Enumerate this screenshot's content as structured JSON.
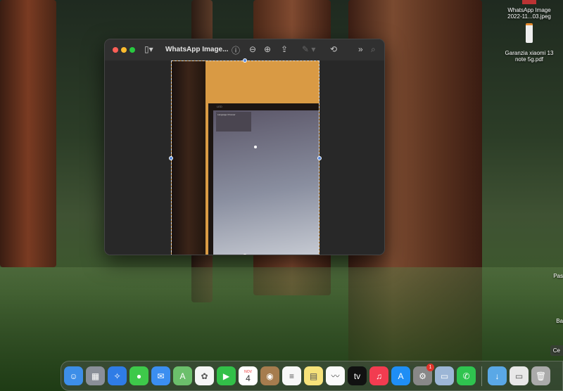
{
  "desktop": {
    "files": [
      {
        "name": "WhatsApp Image 2022-11...03.jpeg",
        "line1": "WhatsApp Image",
        "line2": "2022-11...03.jpeg"
      },
      {
        "name": "Garanzia xiaomi 13 note 5g.pdf",
        "line1": "Garanzia xiaomi 13",
        "line2": "note 5g.pdf"
      }
    ],
    "edge_labels": [
      "Pas",
      "Ba",
      "Ce"
    ]
  },
  "preview": {
    "title": "WhatsApp Image...",
    "toolbar": [
      "sidebar-toggle",
      "info",
      "zoom-out",
      "zoom-in",
      "share",
      "markup",
      "rotate",
      "more",
      "search"
    ],
    "photo_screen_text": "Language Chooser",
    "monitor_label": "LED"
  },
  "dock": {
    "apps": [
      {
        "name": "Finder",
        "color": "#3d8ee8",
        "glyph": "☺"
      },
      {
        "name": "Launchpad",
        "color": "#8a8f99",
        "glyph": "▦"
      },
      {
        "name": "Safari",
        "color": "#2f7ce6",
        "glyph": "✧"
      },
      {
        "name": "Messages",
        "color": "#3ec94a",
        "glyph": "●"
      },
      {
        "name": "Mail",
        "color": "#3b8ef0",
        "glyph": "✉"
      },
      {
        "name": "Maps",
        "color": "#6bbf6b",
        "glyph": "A"
      },
      {
        "name": "Photos",
        "color": "#f5f5f5",
        "glyph": "✿"
      },
      {
        "name": "FaceTime",
        "color": "#32c048",
        "glyph": "▶"
      },
      {
        "name": "Calendar",
        "color": "#ffffff",
        "month": "NOV",
        "day": "4"
      },
      {
        "name": "Contacts",
        "color": "#a67c4e",
        "glyph": "◉"
      },
      {
        "name": "Reminders",
        "color": "#f7f7f7",
        "glyph": "≡"
      },
      {
        "name": "Notes",
        "color": "#f6e27a",
        "glyph": "▤"
      },
      {
        "name": "Freeform",
        "color": "#fafafa",
        "glyph": "〰"
      },
      {
        "name": "TV",
        "color": "#111111",
        "glyph": "tv"
      },
      {
        "name": "Music",
        "color": "#f23c50",
        "glyph": "♫"
      },
      {
        "name": "App Store",
        "color": "#1f8ef5",
        "glyph": "A"
      },
      {
        "name": "System Settings",
        "color": "#888888",
        "glyph": "⚙",
        "badge": "1"
      },
      {
        "name": "Preview",
        "color": "#9cb6d6",
        "glyph": "▭"
      },
      {
        "name": "WhatsApp",
        "color": "#2fc44f",
        "glyph": "✆"
      }
    ],
    "right": [
      {
        "name": "Downloads",
        "color": "#5aa8e6",
        "glyph": "↓"
      },
      {
        "name": "Recent document",
        "color": "#e8e8e8",
        "glyph": "▭"
      },
      {
        "name": "Trash",
        "color": "#aaaaaa",
        "glyph": "🗑"
      }
    ]
  }
}
